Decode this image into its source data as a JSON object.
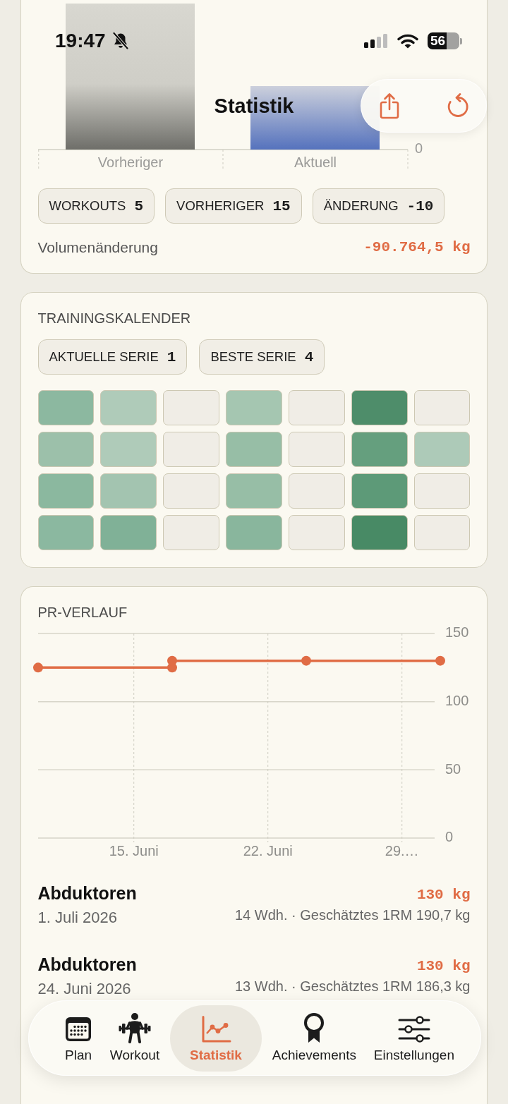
{
  "status_bar": {
    "time": "19:47",
    "silent": true,
    "battery": "56"
  },
  "nav": {
    "title": "Statistik"
  },
  "volume_card": {
    "x_labels": [
      "Vorheriger",
      "Aktuell"
    ],
    "y_tick_label": "0",
    "stats": [
      {
        "label": "WORKOUTS",
        "value": "5"
      },
      {
        "label": "VORHERIGER",
        "value": "15"
      },
      {
        "label": "ÄNDERUNG",
        "value": "-10"
      }
    ],
    "change_label": "Volumenänderung",
    "change_value": "-90.764,5 kg"
  },
  "calendar": {
    "title": "TRAININGSKALENDER",
    "streaks": [
      {
        "label": "AKTUELLE SERIE",
        "value": "1"
      },
      {
        "label": "BESTE SERIE",
        "value": "4"
      }
    ],
    "weeks": [
      [
        {
          "color": "#8cb8a0"
        },
        {
          "color": "#afcbb9"
        },
        {
          "color": "#f0ede6"
        },
        {
          "color": "#a5c6b1"
        },
        {
          "color": "#f0ede6"
        },
        {
          "color": "#4e8d6a"
        },
        {
          "color": "#f0ede6"
        }
      ],
      [
        {
          "color": "#9cc0aa"
        },
        {
          "color": "#afcbb9"
        },
        {
          "color": "#f0ede6"
        },
        {
          "color": "#97bea6"
        },
        {
          "color": "#f0ede6"
        },
        {
          "color": "#659f7e"
        },
        {
          "color": "#adcab8"
        }
      ],
      [
        {
          "color": "#8bb89f"
        },
        {
          "color": "#a3c4b0"
        },
        {
          "color": "#f0ede6"
        },
        {
          "color": "#97bea6"
        },
        {
          "color": "#f0ede6"
        },
        {
          "color": "#5d9a78"
        },
        {
          "color": "#f0ede6"
        }
      ],
      [
        {
          "color": "#8bb8a0"
        },
        {
          "color": "#80b197"
        },
        {
          "color": "#f0ede6"
        },
        {
          "color": "#89b69d"
        },
        {
          "color": "#f0ede6"
        },
        {
          "color": "#488a65"
        },
        {
          "color": "#f0ede6"
        }
      ]
    ]
  },
  "pr_card": {
    "title": "PR-VERLAUF",
    "chart_data": {
      "type": "line",
      "grid": true,
      "categories": [
        null,
        null,
        null,
        null,
        null,
        "15. Juni",
        null,
        null,
        null,
        null,
        null,
        null,
        "22. Juni",
        null,
        null,
        null,
        null,
        null,
        null,
        "29.…",
        null,
        null
      ],
      "series": [
        {
          "color": "#e06c45",
          "marker": "circle",
          "values": [
            125,
            null,
            null,
            null,
            null,
            null,
            null,
            125,
            null,
            null,
            null,
            null,
            null,
            null,
            null,
            null,
            null,
            null,
            null,
            null,
            null,
            null
          ]
        },
        {
          "color": "#e06c45",
          "marker": "circle",
          "values": [
            null,
            null,
            null,
            null,
            null,
            null,
            null,
            130,
            null,
            null,
            null,
            null,
            null,
            null,
            130,
            null,
            null,
            null,
            null,
            null,
            null,
            130
          ]
        }
      ],
      "ylim": [
        0,
        150
      ],
      "yticks": [
        0,
        50,
        100,
        150
      ]
    },
    "entries": [
      {
        "exercise": "Abduktoren",
        "date": "1. Juli 2026",
        "weight": "130 kg",
        "details": "14 Wdh. · Geschätztes 1RM 190,7 kg"
      },
      {
        "exercise": "Abduktoren",
        "date": "24. Juni 2026",
        "weight": "130 kg",
        "details": "13 Wdh. · Geschätztes 1RM 186,3 kg"
      }
    ]
  },
  "tab_bar": [
    {
      "label": "Plan",
      "selected": false
    },
    {
      "label": "Workout",
      "selected": false
    },
    {
      "label": "Statistik",
      "selected": true
    },
    {
      "label": "Achievements",
      "selected": false
    },
    {
      "label": "Einstellungen",
      "selected": false
    }
  ]
}
